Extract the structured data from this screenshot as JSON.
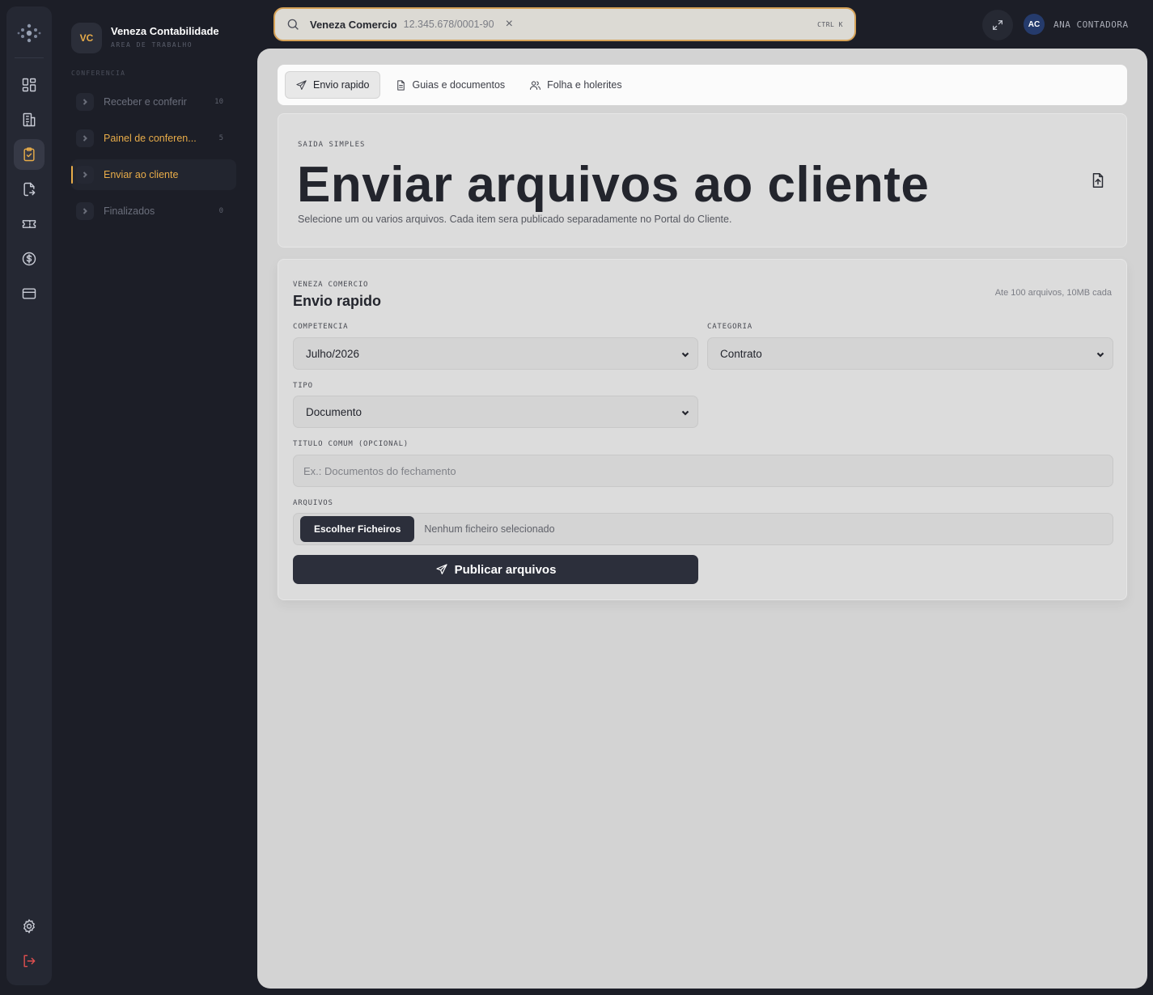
{
  "workspace": {
    "initials": "VC",
    "name": "Veneza Contabilidade",
    "subtitle": "AREA DE TRABALHO"
  },
  "rail": {
    "icons": [
      "logo-icon",
      "dashboard-icon",
      "building-icon",
      "clipboard-check-icon",
      "file-transfer-icon",
      "ticket-icon",
      "dollar-icon",
      "card-icon",
      "settings-icon",
      "logout-icon"
    ],
    "active": "clipboard-check-icon"
  },
  "sidebar": {
    "section": "CONFERENCIA",
    "items": [
      {
        "label": "Receber e conferir",
        "count": "10"
      },
      {
        "label": "Painel de conferen...",
        "count": "5"
      },
      {
        "label": "Enviar ao cliente",
        "count": ""
      },
      {
        "label": "Finalizados",
        "count": "0"
      }
    ]
  },
  "search": {
    "client": "Veneza Comercio",
    "cnpj": "12.345.678/0001-90",
    "clear": "×",
    "shortcut": "CTRL K"
  },
  "user": {
    "initials": "AC",
    "name": "ANA CONTADORA"
  },
  "tabs": [
    {
      "label": "Envio rapido",
      "icon": "send-icon",
      "active": true
    },
    {
      "label": "Guias e documentos",
      "icon": "document-icon",
      "active": false
    },
    {
      "label": "Folha e holerites",
      "icon": "users-icon",
      "active": false
    }
  ],
  "hero": {
    "eyebrow": "SAIDA SIMPLES",
    "title": "Enviar arquivos ao cliente",
    "description": "Selecione um ou varios arquivos. Cada item sera publicado separadamente no Portal do Cliente."
  },
  "form": {
    "eyebrow": "VENEZA COMERCIO",
    "title": "Envio rapido",
    "limit": "Ate 100 arquivos, 10MB cada",
    "competencia_label": "COMPETENCIA",
    "competencia_value": "Julho/2026",
    "categoria_label": "CATEGORIA",
    "categoria_value": "Contrato",
    "tipo_label": "TIPO",
    "tipo_value": "Documento",
    "titulo_label": "TITULO COMUM (OPCIONAL)",
    "titulo_placeholder": "Ex.: Documentos do fechamento",
    "arquivos_label": "ARQUIVOS",
    "file_button": "Escolher Ficheiros",
    "file_status": "Nenhum ficheiro selecionado",
    "publish_label": "Publicar arquivos"
  },
  "colors": {
    "accent": "#e8ac49",
    "dark": "#1c1e27",
    "danger": "#e04f4f",
    "button": "#2c2f3b"
  }
}
